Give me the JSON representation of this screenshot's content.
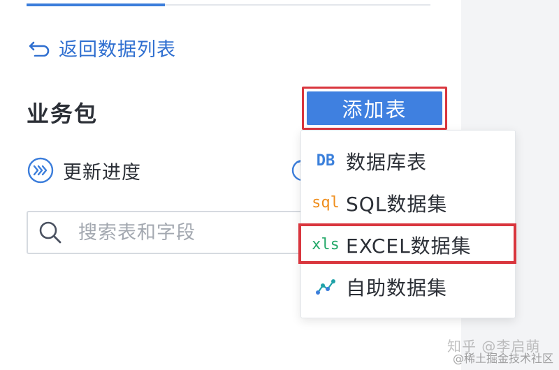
{
  "nav": {
    "back_label": "返回数据列表"
  },
  "package": {
    "title": "业务包",
    "add_table_label": "添加表",
    "progress_label": "更新进度"
  },
  "search": {
    "placeholder": "搜索表和字段",
    "value": ""
  },
  "add_table_menu": {
    "items": [
      {
        "icon": "database-table-icon",
        "icon_text": "DB",
        "label": "数据库表"
      },
      {
        "icon": "sql-dataset-icon",
        "icon_text": "sql",
        "label": "SQL数据集"
      },
      {
        "icon": "excel-dataset-icon",
        "icon_text": "xls",
        "label": "EXCEL数据集",
        "highlighted": true
      },
      {
        "icon": "self-service-dataset-icon",
        "icon_text": "",
        "label": "自助数据集"
      }
    ]
  },
  "watermark": {
    "line1": "知乎 @李启萌",
    "line2": "@稀土掘金技术社区"
  },
  "colors": {
    "accent": "#3f80e0",
    "link": "#2f6fd0",
    "highlight_border": "#d9363e",
    "sql_icon": "#ef8e1d",
    "xls_icon": "#22a868"
  }
}
